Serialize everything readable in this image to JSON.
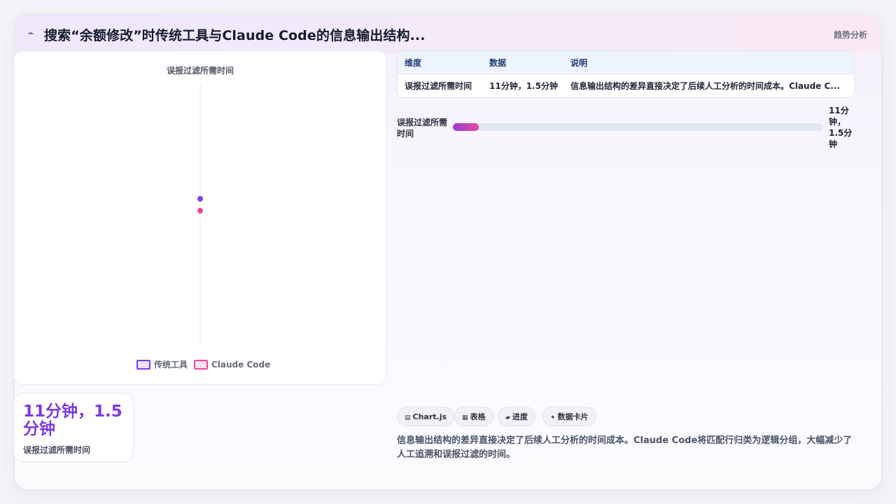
{
  "header": {
    "icon": "trend-line-icon",
    "icon_glyph": "⌁",
    "title": "搜索“余额修改”时传统工具与Claude Code的信息输出结构...",
    "tag": "趋势分析"
  },
  "chart_data": {
    "type": "line",
    "categories": [
      "误报过滤所需时间"
    ],
    "x_tick_labels": [
      "误报过滤所需时间"
    ],
    "series": [
      {
        "name": "传统工具",
        "values": [
          11
        ],
        "color": "#7c3aed"
      },
      {
        "name": "Claude Code",
        "values": [
          1.5
        ],
        "color": "#ec4899"
      }
    ],
    "legend_position": "bottom",
    "grid": true
  },
  "stat": {
    "value": "11分钟，1.5分钟",
    "label": "误报过滤所需时间"
  },
  "table": {
    "headers": [
      "维度",
      "数据",
      "说明"
    ],
    "rows": [
      [
        "误报过滤所需时间",
        "11分钟，1.5分钟",
        "信息输出结构的差异直接决定了后续人工分析的时间成本。Claude C..."
      ]
    ]
  },
  "progress": {
    "label": "误报过滤所需时间",
    "value_text": "11分钟，1.5分钟",
    "fraction": 0.07
  },
  "chips": [
    {
      "icon": "chart-icon",
      "glyph": "▤",
      "label": "Chart.js"
    },
    {
      "icon": "table-icon",
      "glyph": "▦",
      "label": "表格"
    },
    {
      "icon": "progress-icon",
      "glyph": "▰",
      "label": "进度"
    },
    {
      "icon": "sparkle-icon",
      "glyph": "✦",
      "label": "数据卡片"
    }
  ],
  "description": "信息输出结构的差异直接决定了后续人工分析的时间成本。Claude Code将匹配行归类为逻辑分组，大幅减少了人工追溯和误报过滤的时间。",
  "colors": {
    "accent_purple": "#7c3aed",
    "accent_pink": "#ec4899",
    "stat_value": "#7e3ae0"
  }
}
